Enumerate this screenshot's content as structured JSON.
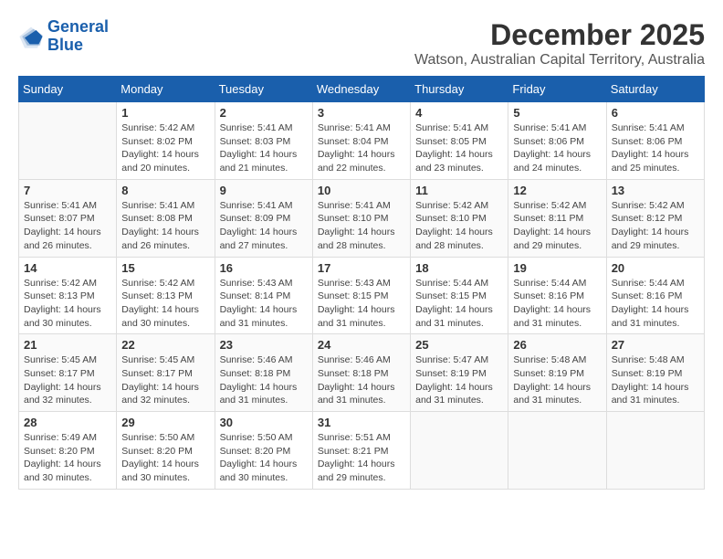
{
  "logo": {
    "line1": "General",
    "line2": "Blue"
  },
  "title": "December 2025",
  "subtitle": "Watson, Australian Capital Territory, Australia",
  "weekdays": [
    "Sunday",
    "Monday",
    "Tuesday",
    "Wednesday",
    "Thursday",
    "Friday",
    "Saturday"
  ],
  "weeks": [
    [
      {
        "day": "",
        "detail": ""
      },
      {
        "day": "1",
        "detail": "Sunrise: 5:42 AM\nSunset: 8:02 PM\nDaylight: 14 hours\nand 20 minutes."
      },
      {
        "day": "2",
        "detail": "Sunrise: 5:41 AM\nSunset: 8:03 PM\nDaylight: 14 hours\nand 21 minutes."
      },
      {
        "day": "3",
        "detail": "Sunrise: 5:41 AM\nSunset: 8:04 PM\nDaylight: 14 hours\nand 22 minutes."
      },
      {
        "day": "4",
        "detail": "Sunrise: 5:41 AM\nSunset: 8:05 PM\nDaylight: 14 hours\nand 23 minutes."
      },
      {
        "day": "5",
        "detail": "Sunrise: 5:41 AM\nSunset: 8:06 PM\nDaylight: 14 hours\nand 24 minutes."
      },
      {
        "day": "6",
        "detail": "Sunrise: 5:41 AM\nSunset: 8:06 PM\nDaylight: 14 hours\nand 25 minutes."
      }
    ],
    [
      {
        "day": "7",
        "detail": "Sunrise: 5:41 AM\nSunset: 8:07 PM\nDaylight: 14 hours\nand 26 minutes."
      },
      {
        "day": "8",
        "detail": "Sunrise: 5:41 AM\nSunset: 8:08 PM\nDaylight: 14 hours\nand 26 minutes."
      },
      {
        "day": "9",
        "detail": "Sunrise: 5:41 AM\nSunset: 8:09 PM\nDaylight: 14 hours\nand 27 minutes."
      },
      {
        "day": "10",
        "detail": "Sunrise: 5:41 AM\nSunset: 8:10 PM\nDaylight: 14 hours\nand 28 minutes."
      },
      {
        "day": "11",
        "detail": "Sunrise: 5:42 AM\nSunset: 8:10 PM\nDaylight: 14 hours\nand 28 minutes."
      },
      {
        "day": "12",
        "detail": "Sunrise: 5:42 AM\nSunset: 8:11 PM\nDaylight: 14 hours\nand 29 minutes."
      },
      {
        "day": "13",
        "detail": "Sunrise: 5:42 AM\nSunset: 8:12 PM\nDaylight: 14 hours\nand 29 minutes."
      }
    ],
    [
      {
        "day": "14",
        "detail": "Sunrise: 5:42 AM\nSunset: 8:13 PM\nDaylight: 14 hours\nand 30 minutes."
      },
      {
        "day": "15",
        "detail": "Sunrise: 5:42 AM\nSunset: 8:13 PM\nDaylight: 14 hours\nand 30 minutes."
      },
      {
        "day": "16",
        "detail": "Sunrise: 5:43 AM\nSunset: 8:14 PM\nDaylight: 14 hours\nand 31 minutes."
      },
      {
        "day": "17",
        "detail": "Sunrise: 5:43 AM\nSunset: 8:15 PM\nDaylight: 14 hours\nand 31 minutes."
      },
      {
        "day": "18",
        "detail": "Sunrise: 5:44 AM\nSunset: 8:15 PM\nDaylight: 14 hours\nand 31 minutes."
      },
      {
        "day": "19",
        "detail": "Sunrise: 5:44 AM\nSunset: 8:16 PM\nDaylight: 14 hours\nand 31 minutes."
      },
      {
        "day": "20",
        "detail": "Sunrise: 5:44 AM\nSunset: 8:16 PM\nDaylight: 14 hours\nand 31 minutes."
      }
    ],
    [
      {
        "day": "21",
        "detail": "Sunrise: 5:45 AM\nSunset: 8:17 PM\nDaylight: 14 hours\nand 32 minutes."
      },
      {
        "day": "22",
        "detail": "Sunrise: 5:45 AM\nSunset: 8:17 PM\nDaylight: 14 hours\nand 32 minutes."
      },
      {
        "day": "23",
        "detail": "Sunrise: 5:46 AM\nSunset: 8:18 PM\nDaylight: 14 hours\nand 31 minutes."
      },
      {
        "day": "24",
        "detail": "Sunrise: 5:46 AM\nSunset: 8:18 PM\nDaylight: 14 hours\nand 31 minutes."
      },
      {
        "day": "25",
        "detail": "Sunrise: 5:47 AM\nSunset: 8:19 PM\nDaylight: 14 hours\nand 31 minutes."
      },
      {
        "day": "26",
        "detail": "Sunrise: 5:48 AM\nSunset: 8:19 PM\nDaylight: 14 hours\nand 31 minutes."
      },
      {
        "day": "27",
        "detail": "Sunrise: 5:48 AM\nSunset: 8:19 PM\nDaylight: 14 hours\nand 31 minutes."
      }
    ],
    [
      {
        "day": "28",
        "detail": "Sunrise: 5:49 AM\nSunset: 8:20 PM\nDaylight: 14 hours\nand 30 minutes."
      },
      {
        "day": "29",
        "detail": "Sunrise: 5:50 AM\nSunset: 8:20 PM\nDaylight: 14 hours\nand 30 minutes."
      },
      {
        "day": "30",
        "detail": "Sunrise: 5:50 AM\nSunset: 8:20 PM\nDaylight: 14 hours\nand 30 minutes."
      },
      {
        "day": "31",
        "detail": "Sunrise: 5:51 AM\nSunset: 8:21 PM\nDaylight: 14 hours\nand 29 minutes."
      },
      {
        "day": "",
        "detail": ""
      },
      {
        "day": "",
        "detail": ""
      },
      {
        "day": "",
        "detail": ""
      }
    ]
  ]
}
